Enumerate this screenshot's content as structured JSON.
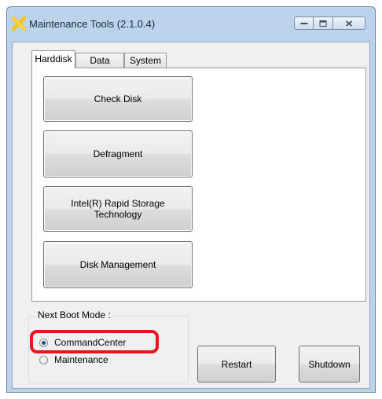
{
  "window": {
    "title": "Maintenance Tools (2.1.0.4)",
    "icon": "tools-x-icon",
    "caption_buttons": [
      "minimize-icon",
      "maximize-icon",
      "close-icon"
    ]
  },
  "tabs": [
    {
      "label": "Harddisk",
      "selected": true
    },
    {
      "label": "Data",
      "selected": false
    },
    {
      "label": "System",
      "selected": false
    }
  ],
  "harddisk_panel": {
    "check_disk": "Check Disk",
    "defragment": "Defragment",
    "intel_rst": "Intel(R) Rapid Storage Technology",
    "disk_management": "Disk Management"
  },
  "boot_mode": {
    "label": "Next Boot Mode :",
    "options": [
      {
        "label": "CommandCenter",
        "checked": true
      },
      {
        "label": "Maintenance",
        "checked": false
      }
    ]
  },
  "actions": {
    "restart": "Restart",
    "shutdown": "Shutdown"
  },
  "colors": {
    "highlight": "#e8141f",
    "frame": "#bcd3ec",
    "icon": "#f5c518"
  }
}
